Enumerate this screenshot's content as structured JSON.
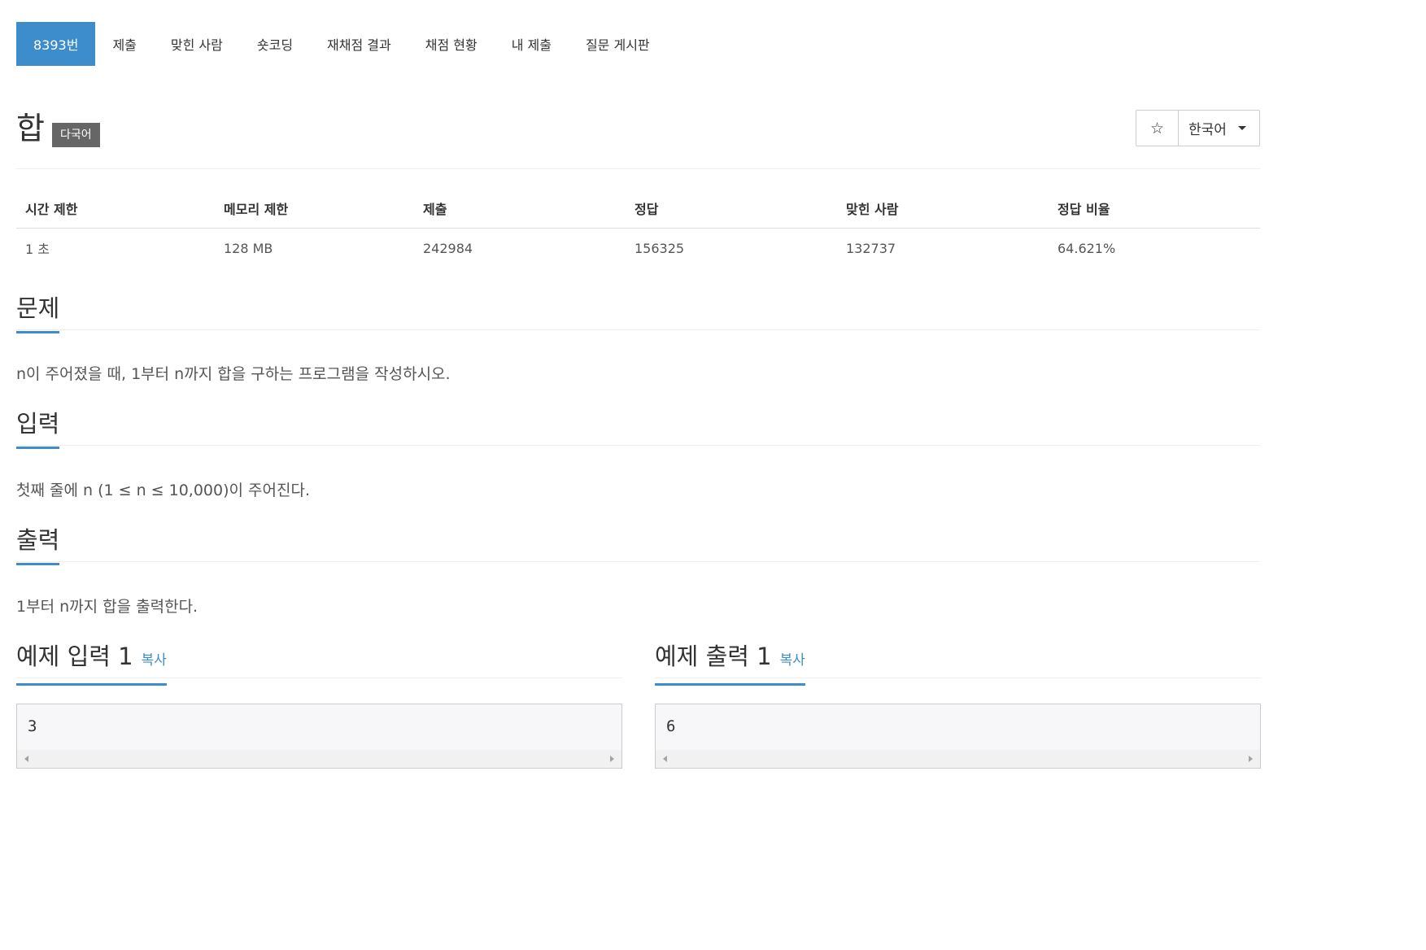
{
  "nav": {
    "tabs": [
      {
        "label": "8393번",
        "active": true
      },
      {
        "label": "제출"
      },
      {
        "label": "맞힌 사람"
      },
      {
        "label": "숏코딩"
      },
      {
        "label": "재채점 결과"
      },
      {
        "label": "채점 현황"
      },
      {
        "label": "내 제출"
      },
      {
        "label": "질문 게시판"
      }
    ]
  },
  "problem": {
    "title": "합",
    "badge": "다국어",
    "star_icon": "☆",
    "language": "한국어"
  },
  "stats": {
    "headers": [
      "시간 제한",
      "메모리 제한",
      "제출",
      "정답",
      "맞힌 사람",
      "정답 비율"
    ],
    "values": [
      "1 초",
      "128 MB",
      "242984",
      "156325",
      "132737",
      "64.621%"
    ]
  },
  "sections": {
    "problem": {
      "heading": "문제",
      "text": "n이 주어졌을 때, 1부터 n까지 합을 구하는 프로그램을 작성하시오."
    },
    "input": {
      "heading": "입력",
      "text": "첫째 줄에 n (1 ≤ n ≤ 10,000)이 주어진다."
    },
    "output": {
      "heading": "출력",
      "text": "1부터 n까지 합을 출력한다."
    }
  },
  "samples": {
    "input": {
      "heading": "예제 입력 1",
      "copy_label": "복사",
      "value": "3"
    },
    "output": {
      "heading": "예제 출력 1",
      "copy_label": "복사",
      "value": "6"
    }
  },
  "colors": {
    "accent": "#3d8ccc",
    "badge_bg": "#666666"
  }
}
